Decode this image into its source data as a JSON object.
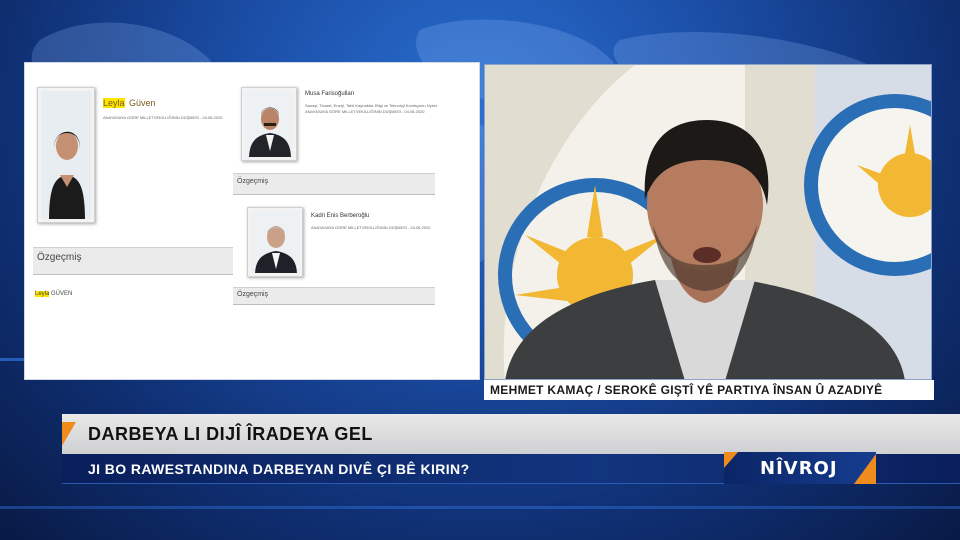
{
  "document": {
    "person1": {
      "first_name": "Leyla",
      "last_name": "Güven",
      "subline": "ANAYASAYA GÖRE MİLLETVEKİLLİĞİNİN DÜŞMESİ - 04.06.2020",
      "section_label": "Özgeçmiş",
      "bio_first": "Leyla",
      "bio_last": "GÜVEN"
    },
    "person2": {
      "name": "Musa Farisoğulları",
      "role": "Sanayi, Ticaret, Enerji, Tabii Kaynaklar, Bilgi ve Teknoloji Komisyonu Üyesi",
      "subline": "ANAYASAYA GÖRE MİLLETVEKİLLİĞİNİN DÜŞMESİ - 04.06.2020",
      "section_label": "Özgeçmiş"
    },
    "person3": {
      "name": "Kadri Enis Berberoğlu",
      "subline": "ANAYASAYA GÖRE MİLLETVEKİLLİĞİNİN DÜŞMESİ - 04.06.2020",
      "section_label": "Özgeçmiş"
    }
  },
  "guest_caption": "MEHMET KAMAÇ / SEROKÊ GIŞTÎ YÊ PARTIYA ÎNSAN Û AZADIYÊ",
  "headline": "DARBEYA LI DIJÎ ÎRADEYA GEL",
  "subheadline": "JI BO RAWESTANDINA DARBEYAN DIVÊ ÇI BÊ KIRIN?",
  "program_logo": "NÎVROJ",
  "colors": {
    "accent_orange": "#f08c1c",
    "navy": "#0a1f5c",
    "background_blue": "#1b4fa8"
  }
}
